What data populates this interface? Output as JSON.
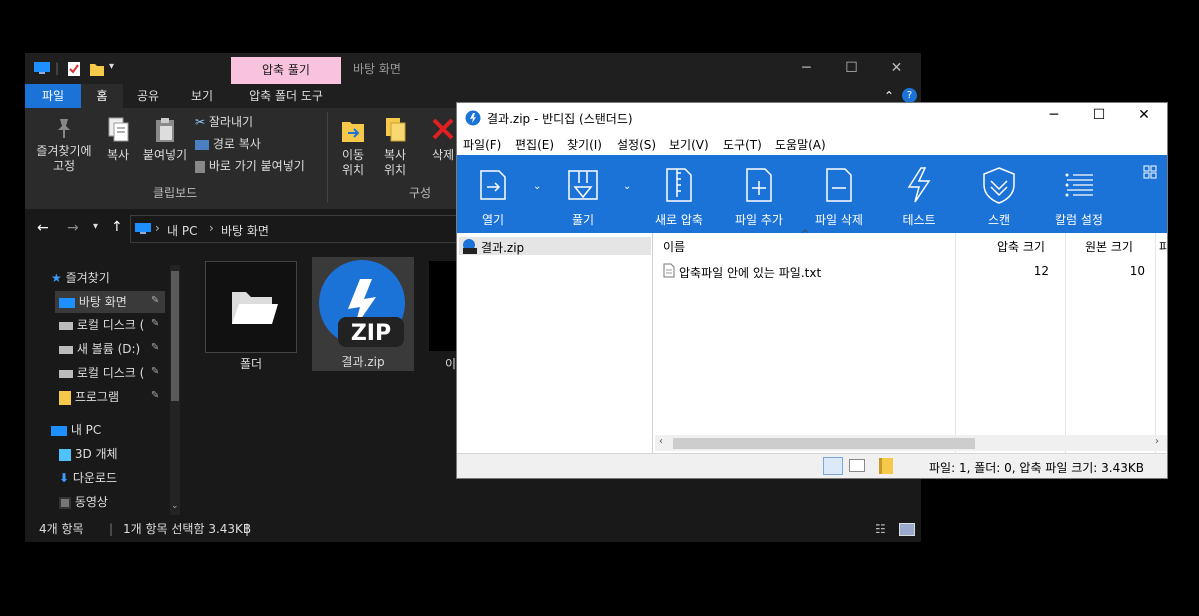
{
  "explorer": {
    "window_title": "바탕 화면",
    "context_tab_title": "압축 풀기",
    "tabs": [
      {
        "label": "파일"
      },
      {
        "label": "홈"
      },
      {
        "label": "공유"
      },
      {
        "label": "보기"
      },
      {
        "label": "압축 폴더 도구"
      }
    ],
    "ribbon": {
      "pin_label_line1": "즐겨찾기에",
      "pin_label_line2": "고정",
      "copy_label": "복사",
      "paste_label": "붙여넣기",
      "cut_label": "잘라내기",
      "copy_path_label": "경로 복사",
      "paste_shortcut_label": "바로 가기 붙여넣기",
      "clipboard_group": "클립보드",
      "move_label_line1": "이동",
      "move_label_line2": "위치",
      "copyto_label_line1": "복사",
      "copyto_label_line2": "위치",
      "delete_label": "삭제",
      "organize_group": "구성"
    },
    "address": {
      "segments": [
        "내 PC",
        "바탕 화면"
      ]
    },
    "nav": {
      "items": [
        {
          "label": "즐겨찾기",
          "icon": "star-icon"
        },
        {
          "label": "바탕 화면",
          "icon": "desktop-icon"
        },
        {
          "label": "로컬 디스크 (",
          "icon": "disk-icon"
        },
        {
          "label": "새 볼륨 (D:)",
          "icon": "disk-icon"
        },
        {
          "label": "로컬 디스크 (",
          "icon": "disk-icon"
        },
        {
          "label": "프로그램",
          "icon": "folder-icon"
        },
        {
          "label": "내 PC",
          "icon": "pc-icon"
        },
        {
          "label": "3D 개체",
          "icon": "cube-icon"
        },
        {
          "label": "다운로드",
          "icon": "download-icon"
        },
        {
          "label": "동영상",
          "icon": "video-icon"
        }
      ]
    },
    "files": [
      {
        "name": "폴더",
        "icon": "folder-icon"
      },
      {
        "name": "결과.zip",
        "icon": "bandizip-zip-icon",
        "badge": "ZIP"
      },
      {
        "name": "이",
        "icon": "file-icon"
      }
    ],
    "status": {
      "item_count": "4개 항목",
      "selection": "1개 항목 선택함 3.43KB"
    },
    "colors": {
      "context_tab": "#f9c3dd",
      "active_tab": "#1b73d8"
    }
  },
  "bandizip": {
    "window_title": "결과.zip - 반디집 (스탠더드)",
    "menu": [
      "파일(F)",
      "편집(E)",
      "찾기(I)",
      "설정(S)",
      "보기(V)",
      "도구(T)",
      "도움말(A)"
    ],
    "toolbar": [
      {
        "label": "열기",
        "icon": "open-icon"
      },
      {
        "label": "풀기",
        "icon": "extract-icon"
      },
      {
        "label": "새로 압축",
        "icon": "new-archive-icon"
      },
      {
        "label": "파일 추가",
        "icon": "add-file-icon"
      },
      {
        "label": "파일 삭제",
        "icon": "delete-file-icon"
      },
      {
        "label": "테스트",
        "icon": "test-icon"
      },
      {
        "label": "스캔",
        "icon": "scan-icon"
      },
      {
        "label": "칼럼 설정",
        "icon": "columns-icon"
      }
    ],
    "tree": [
      {
        "label": "결과.zip"
      }
    ],
    "columns": [
      {
        "label": "이름"
      },
      {
        "label": "압축 크기"
      },
      {
        "label": "원본 크기"
      },
      {
        "label": "파"
      }
    ],
    "rows": [
      {
        "name": "압축파일 안에 있는 파일.txt",
        "packed": "12",
        "original": "10"
      }
    ],
    "status_text": "파일: 1, 폴더: 0, 압축 파일 크기: 3.43KB",
    "colors": {
      "toolbar_bg": "#1b73d8"
    }
  }
}
